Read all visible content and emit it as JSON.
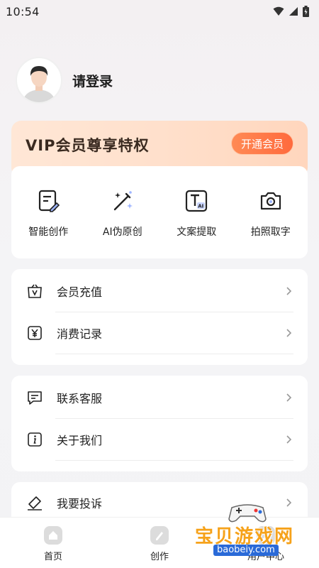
{
  "status_bar": {
    "time": "10:54"
  },
  "profile": {
    "login_text": "请登录"
  },
  "vip": {
    "title": "VIP会员尊享特权",
    "button": "开通会员"
  },
  "features": [
    {
      "label": "智能创作",
      "icon": "edit-document-icon"
    },
    {
      "label": "AI伪原创",
      "icon": "magic-wand-icon"
    },
    {
      "label": "文案提取",
      "icon": "text-ai-icon"
    },
    {
      "label": "拍照取字",
      "icon": "camera-icon"
    }
  ],
  "menu_group_1": [
    {
      "label": "会员充值",
      "icon": "vip-bag-icon"
    },
    {
      "label": "消费记录",
      "icon": "yuan-receipt-icon"
    }
  ],
  "menu_group_2": [
    {
      "label": "联系客服",
      "icon": "chat-message-icon"
    },
    {
      "label": "关于我们",
      "icon": "info-icon"
    }
  ],
  "menu_group_3": [
    {
      "label": "我要投诉",
      "icon": "complaint-icon"
    }
  ],
  "tabbar": [
    {
      "label": "首页",
      "icon": "home-icon"
    },
    {
      "label": "创作",
      "icon": "pen-icon"
    },
    {
      "label": "用户中心",
      "icon": "user-icon"
    }
  ],
  "watermark": {
    "brand": "宝贝游戏网",
    "url": "baobeiy.com"
  },
  "colors": {
    "accent": "#ff6a3d",
    "vip_bg": "#ffe3d0",
    "watermark": "#f6a21a"
  }
}
